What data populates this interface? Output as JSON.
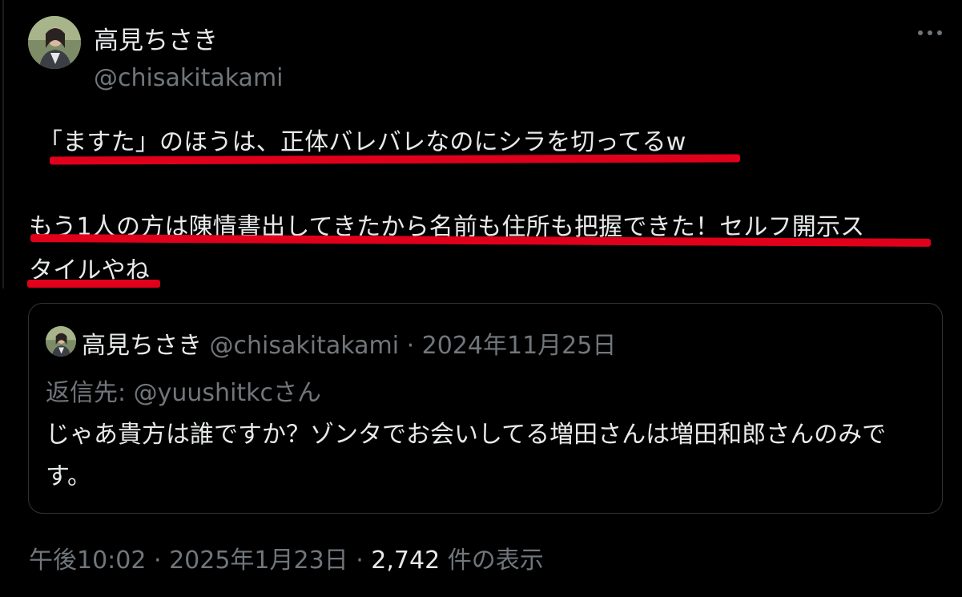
{
  "tweet": {
    "author_name": "高見ちさき",
    "author_handle": "@chisakitakami",
    "line1": "「ますた」のほうは、正体バレバレなのにシラを切ってるw",
    "line2": "もう1人の方は陳情書出してきたから名前も住所も把握できた！セルフ開示ス",
    "line3": "タイルやね"
  },
  "quoted": {
    "author_name": "高見ちさき",
    "handle_and_date": "@chisakitakami · 2024年11月25日",
    "reply_to": "返信先: @yuushitkcさん",
    "text": "じゃあ貴方は誰ですか？ゾンタでお会いしてる増田さんは増田和郎さんのみです。"
  },
  "footer": {
    "time_date": "午後10:02 · 2025年1月23日 · ",
    "views": "2,742",
    "views_label": " 件の表示"
  },
  "icons": {
    "more": "more-horizontal-icon",
    "avatar": "profile-photo"
  },
  "colors": {
    "background": "#000000",
    "text": "#e7e9ea",
    "secondary": "#71767b",
    "underline": "#e0001b"
  }
}
